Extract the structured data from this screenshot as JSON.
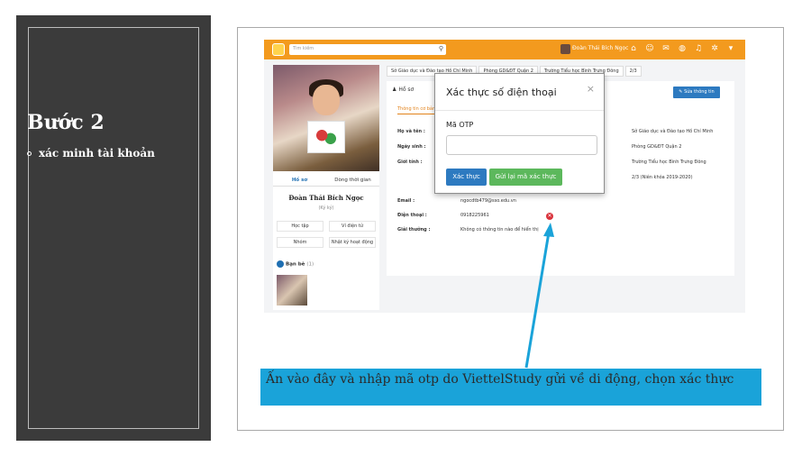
{
  "slide": {
    "title": "Bước 2",
    "bullet": "xác minh tài khoản"
  },
  "app": {
    "search_placeholder": "Tìm kiếm",
    "user_name": "Đoàn Thái Bích Ngọc",
    "top_icons": [
      "home-icon",
      "group-icon",
      "chat-icon",
      "globe-icon",
      "bell-icon",
      "gear-icon",
      "caret-down-icon"
    ],
    "profile": {
      "tabs": [
        "Hồ sơ",
        "Dòng thời gian"
      ],
      "name": "Đoàn Thái Bích Ngọc",
      "subtitle": "(Ký ký)",
      "buttons": [
        "Học tập",
        "Ví điện tử",
        "Nhóm",
        "Nhật ký hoạt động"
      ],
      "friends_label": "Bạn bè",
      "friends_count": "(1)"
    },
    "breadcrumbs": [
      "Sở Giáo dục và Đào tạo Hồ Chí Minh",
      "Phòng GD&ĐT Quận 2",
      "Trường Tiểu học Bình Trưng Đông",
      "2/3"
    ],
    "main": {
      "title": "Hồ sơ",
      "edit_button": "Sửa thông tin",
      "info_tab": "Thông tin cơ bản",
      "fields": [
        {
          "label": "Họ và tên :",
          "value": ""
        },
        {
          "label": "Ngày sinh :",
          "value": ""
        },
        {
          "label": "Giới tính :",
          "value": ""
        },
        {
          "label": "Email :",
          "value": "ngocdtb479@sso.edu.vn"
        },
        {
          "label": "Điện thoại :",
          "value": "0918225961"
        },
        {
          "label": "Giải thưởng :",
          "value": "Không có thông tin nào để hiển thị"
        }
      ],
      "right_values": [
        "Sở Giáo dục và Đào tạo Hồ Chí Minh",
        "Phòng GD&ĐT Quận 2",
        "Trường Tiểu học Bình Trưng Đông",
        "2/3 (Niên khóa 2019-2020)"
      ]
    },
    "modal": {
      "title": "Xác thực số điện thoại",
      "close": "×",
      "otp_label": "Mã OTP",
      "otp_value": "",
      "verify_button": "Xác thực",
      "resend_button": "Gửi lại mã xác thực",
      "verify_color": "#2d7ac0",
      "resend_color": "#5cb85c"
    }
  },
  "caption": "Ấn vào đây và nhập mã otp do ViettelStudy gửi về di động, chọn xác thực",
  "colors": {
    "topbar": "#f39a1e",
    "caption_bg": "#1aa3d9",
    "panel_bg": "#3b3b3b"
  }
}
